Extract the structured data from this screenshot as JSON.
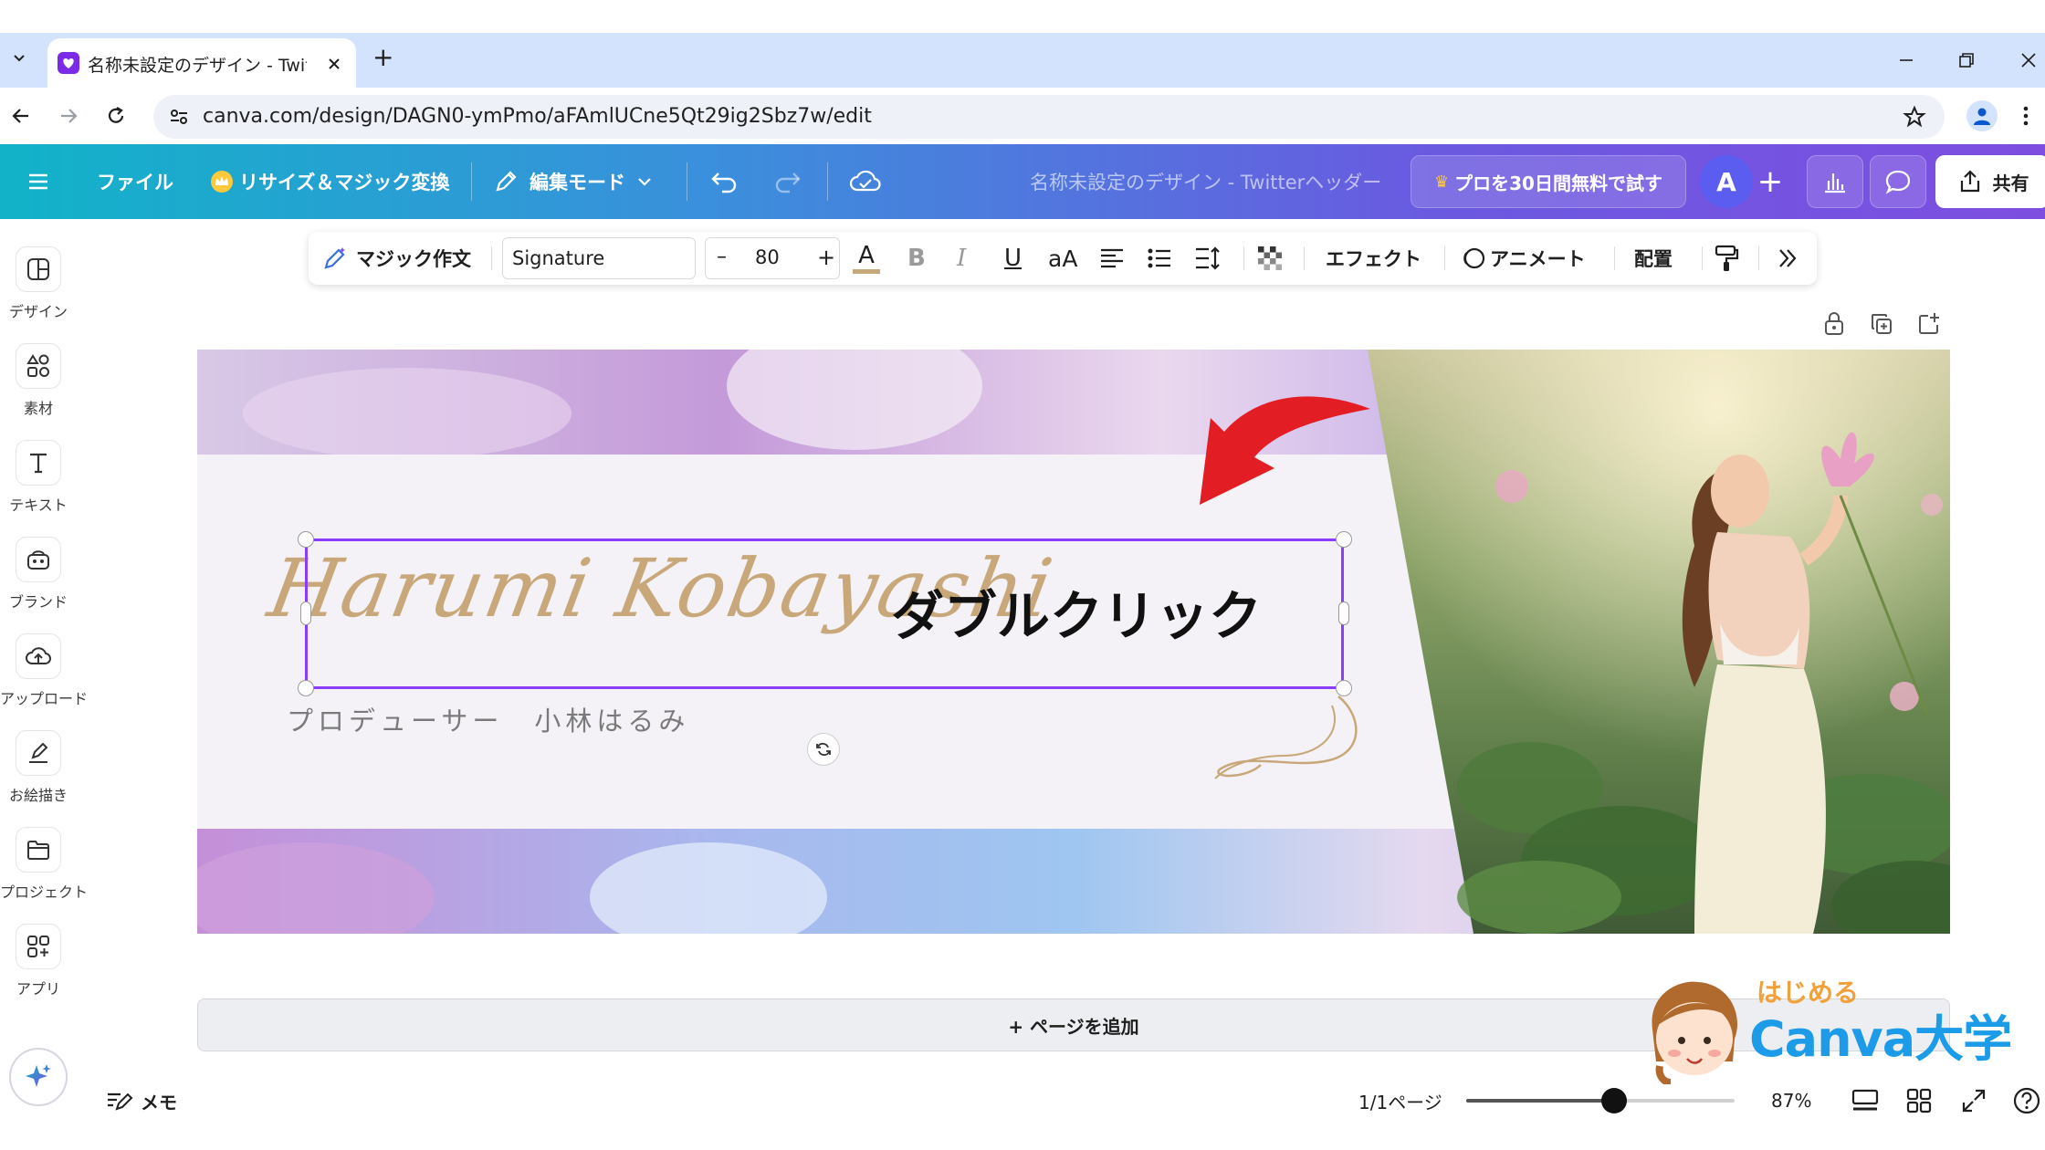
{
  "browser": {
    "tab_title": "名称未設定のデザイン - Twitterヘ",
    "url": "canva.com/design/DAGN0-ymPmo/aFAmlUCne5Qt29ig2Sbz7w/edit",
    "new_tab_label": "+"
  },
  "header": {
    "menu_icon": "hamburger-icon",
    "file_label": "ファイル",
    "resize_label": "リサイズ＆マジック変換",
    "edit_mode_label": "編集モード",
    "doc_title": "名称未設定のデザイン - Twitterヘッダー",
    "pro_label": "プロを30日間無料で試す",
    "avatar_letter": "A",
    "add_label": "+",
    "share_label": "共有",
    "accent_color": "#7d4ee0"
  },
  "rail": {
    "items": [
      {
        "label": "デザイン",
        "icon": "layout-icon"
      },
      {
        "label": "素材",
        "icon": "elements-icon"
      },
      {
        "label": "テキスト",
        "icon": "text-icon"
      },
      {
        "label": "ブランド",
        "icon": "brand-icon"
      },
      {
        "label": "アップロード",
        "icon": "upload-icon"
      },
      {
        "label": "お絵描き",
        "icon": "draw-icon"
      },
      {
        "label": "プロジェクト",
        "icon": "folder-icon"
      },
      {
        "label": "アプリ",
        "icon": "apps-icon"
      }
    ]
  },
  "toolbar": {
    "magic_write_label": "マジック作文",
    "font_name": "Signature",
    "minus_label": "–",
    "font_size": "80",
    "plus_label": "+",
    "color_label": "A",
    "bold_label": "B",
    "italic_label": "I",
    "underline_label": "U",
    "case_label": "aA",
    "effects_label": "エフェクト",
    "animate_label": "アニメート",
    "position_label": "配置"
  },
  "canvas": {
    "signature_text": "Harumi Kobayashi",
    "subtitle_text": "プロデューサー　小林はるみ",
    "callout_text": "ダブルクリック",
    "arrow_color": "#e21d24",
    "selection_color": "#8b3dff"
  },
  "add_page_label": "+ ページを追加",
  "bottom": {
    "notes_label": "メモ",
    "page_indicator": "1/1ページ",
    "zoom_label": "87%",
    "zoom_fraction": 0.55
  },
  "watermark": {
    "top_text": "はじめる",
    "main_text": "Canva大学"
  }
}
